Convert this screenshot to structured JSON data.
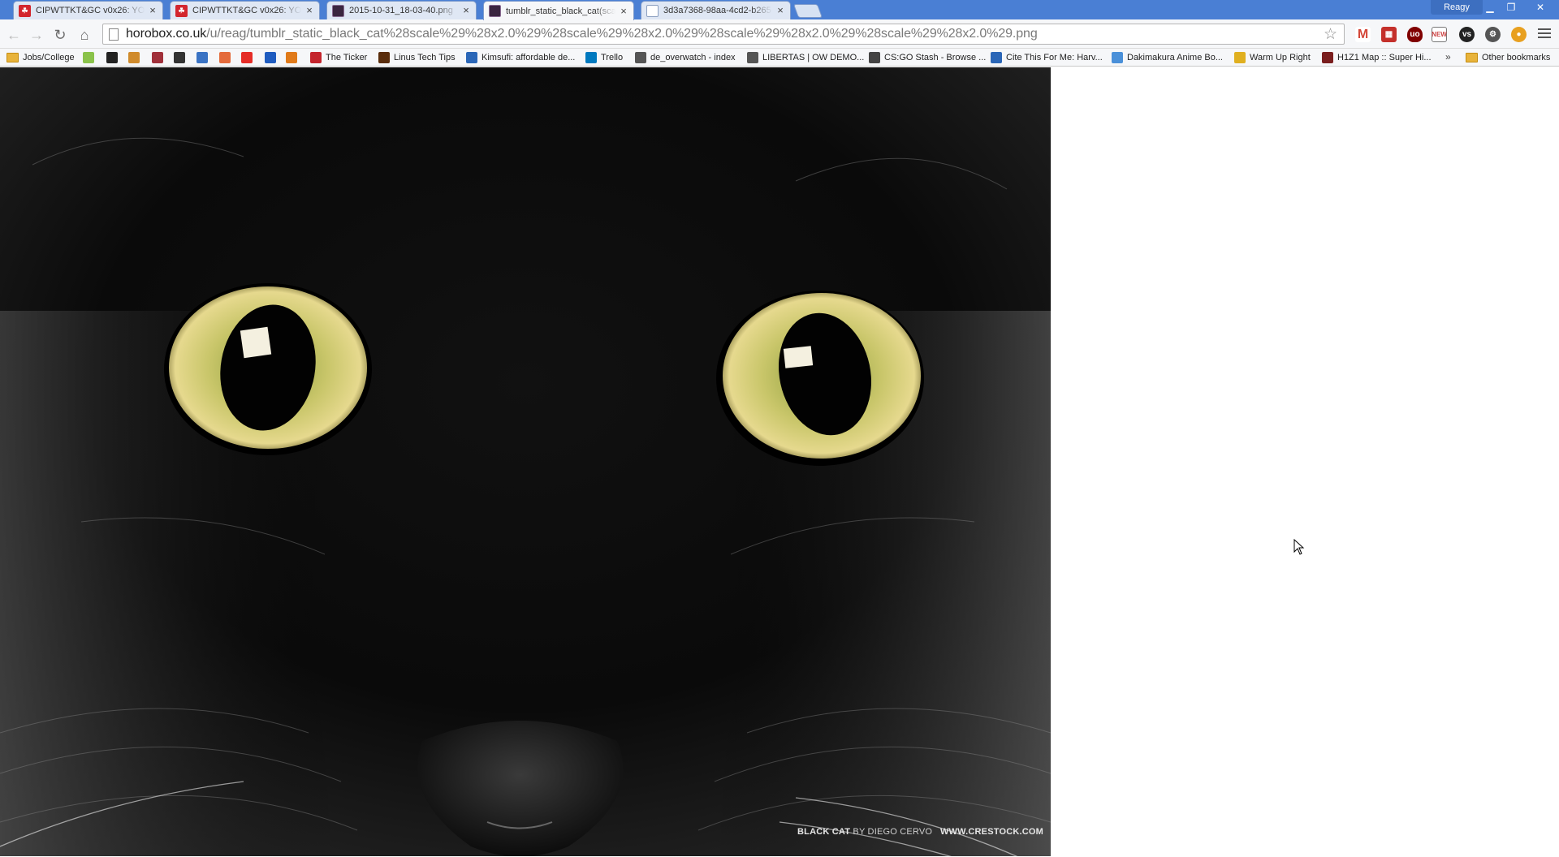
{
  "browser": {
    "tabs": [
      {
        "title": "CIPWTTKT&GC v0x26: YOU",
        "favicon": "red-4chan-icon",
        "active": false
      },
      {
        "title": "CIPWTTKT&GC v0x26: YOU",
        "favicon": "red-4chan-icon",
        "active": false
      },
      {
        "title": "2015-10-31_18-03-40.png",
        "favicon": "horobox-icon",
        "active": false
      },
      {
        "title": "tumblr_static_black_cat(scale",
        "favicon": "horobox-icon",
        "active": true
      },
      {
        "title": "3d3a7368-98aa-4cd2-b265-",
        "favicon": "document-icon",
        "active": false
      }
    ],
    "profile_name": "Reagy",
    "url_host": "horobox.co.uk",
    "url_path": "/u/reag/tumblr_static_black_cat%28scale%29%28x2.0%29%28scale%29%28x2.0%29%28scale%29%28x2.0%29%28scale%29%28x2.0%29.png"
  },
  "bookmarks": [
    {
      "label": "Jobs/College",
      "icon": "folder-icon"
    },
    {
      "label": "",
      "icon": "bookmark-icon",
      "color": "#8ac24a"
    },
    {
      "label": "",
      "icon": "bookmark-icon",
      "color": "#222222"
    },
    {
      "label": "",
      "icon": "bookmark-icon",
      "color": "#d08b2c"
    },
    {
      "label": "",
      "icon": "bookmark-icon",
      "color": "#a0303a"
    },
    {
      "label": "",
      "icon": "amazon-icon",
      "color": "#333333"
    },
    {
      "label": "",
      "icon": "bookmark-icon",
      "color": "#3a73c4"
    },
    {
      "label": "",
      "icon": "bookmark-icon",
      "color": "#e46b3c"
    },
    {
      "label": "",
      "icon": "youtube-icon",
      "color": "#e52d27"
    },
    {
      "label": "",
      "icon": "bookmark-icon",
      "color": "#1f5cc0"
    },
    {
      "label": "",
      "icon": "bookmark-icon",
      "color": "#e07a1a"
    },
    {
      "label": "The Ticker",
      "icon": "bookmark-icon",
      "color": "#c4252d"
    },
    {
      "label": "Linus Tech Tips",
      "icon": "bookmark-icon",
      "color": "#5a2d0c"
    },
    {
      "label": "Kimsufi: affordable de...",
      "icon": "bookmark-icon",
      "color": "#2a66b7"
    },
    {
      "label": "Trello",
      "icon": "trello-icon",
      "color": "#0079bf"
    },
    {
      "label": "de_overwatch - index",
      "icon": "bookmark-icon",
      "color": "#555555"
    },
    {
      "label": "LIBERTAS | OW DEMO...",
      "icon": "bookmark-icon",
      "color": "#555555"
    },
    {
      "label": "CS:GO Stash - Browse ...",
      "icon": "bookmark-icon",
      "color": "#444444"
    },
    {
      "label": "Cite This For Me: Harv...",
      "icon": "bookmark-icon",
      "color": "#2a66b7"
    },
    {
      "label": "Dakimakura Anime Bo...",
      "icon": "bookmark-icon",
      "color": "#4a90d9"
    },
    {
      "label": "Warm Up Right",
      "icon": "bookmark-icon",
      "color": "#e0b020"
    },
    {
      "label": "H1Z1 Map :: Super Hi...",
      "icon": "bookmark-icon",
      "color": "#7a1e1e"
    }
  ],
  "other_bookmarks": "Other bookmarks",
  "image": {
    "alt": "black cat close-up photo",
    "credit_title": "BLACK CAT",
    "credit_by": "BY DIEGO CERVO",
    "credit_site": "WWW.CRESTOCK.COM"
  }
}
